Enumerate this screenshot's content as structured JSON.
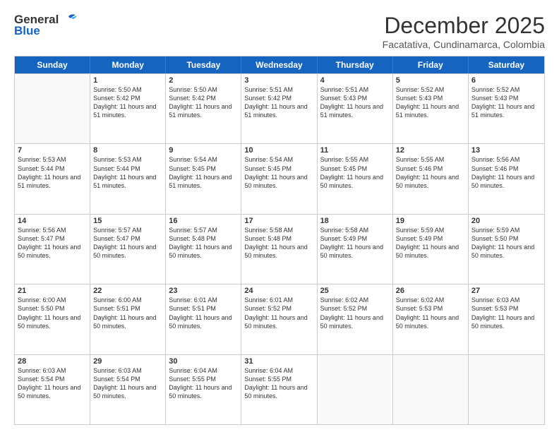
{
  "header": {
    "logo_general": "General",
    "logo_blue": "Blue",
    "month_title": "December 2025",
    "subtitle": "Facatativa, Cundinamarca, Colombia"
  },
  "days_of_week": [
    "Sunday",
    "Monday",
    "Tuesday",
    "Wednesday",
    "Thursday",
    "Friday",
    "Saturday"
  ],
  "weeks": [
    [
      {
        "day": "",
        "empty": true
      },
      {
        "day": "1",
        "sunrise": "5:50 AM",
        "sunset": "5:42 PM",
        "daylight": "11 hours and 51 minutes."
      },
      {
        "day": "2",
        "sunrise": "5:50 AM",
        "sunset": "5:42 PM",
        "daylight": "11 hours and 51 minutes."
      },
      {
        "day": "3",
        "sunrise": "5:51 AM",
        "sunset": "5:42 PM",
        "daylight": "11 hours and 51 minutes."
      },
      {
        "day": "4",
        "sunrise": "5:51 AM",
        "sunset": "5:43 PM",
        "daylight": "11 hours and 51 minutes."
      },
      {
        "day": "5",
        "sunrise": "5:52 AM",
        "sunset": "5:43 PM",
        "daylight": "11 hours and 51 minutes."
      },
      {
        "day": "6",
        "sunrise": "5:52 AM",
        "sunset": "5:43 PM",
        "daylight": "11 hours and 51 minutes."
      }
    ],
    [
      {
        "day": "7",
        "sunrise": "5:53 AM",
        "sunset": "5:44 PM",
        "daylight": "11 hours and 51 minutes."
      },
      {
        "day": "8",
        "sunrise": "5:53 AM",
        "sunset": "5:44 PM",
        "daylight": "11 hours and 51 minutes."
      },
      {
        "day": "9",
        "sunrise": "5:54 AM",
        "sunset": "5:45 PM",
        "daylight": "11 hours and 51 minutes."
      },
      {
        "day": "10",
        "sunrise": "5:54 AM",
        "sunset": "5:45 PM",
        "daylight": "11 hours and 50 minutes."
      },
      {
        "day": "11",
        "sunrise": "5:55 AM",
        "sunset": "5:45 PM",
        "daylight": "11 hours and 50 minutes."
      },
      {
        "day": "12",
        "sunrise": "5:55 AM",
        "sunset": "5:46 PM",
        "daylight": "11 hours and 50 minutes."
      },
      {
        "day": "13",
        "sunrise": "5:56 AM",
        "sunset": "5:46 PM",
        "daylight": "11 hours and 50 minutes."
      }
    ],
    [
      {
        "day": "14",
        "sunrise": "5:56 AM",
        "sunset": "5:47 PM",
        "daylight": "11 hours and 50 minutes."
      },
      {
        "day": "15",
        "sunrise": "5:57 AM",
        "sunset": "5:47 PM",
        "daylight": "11 hours and 50 minutes."
      },
      {
        "day": "16",
        "sunrise": "5:57 AM",
        "sunset": "5:48 PM",
        "daylight": "11 hours and 50 minutes."
      },
      {
        "day": "17",
        "sunrise": "5:58 AM",
        "sunset": "5:48 PM",
        "daylight": "11 hours and 50 minutes."
      },
      {
        "day": "18",
        "sunrise": "5:58 AM",
        "sunset": "5:49 PM",
        "daylight": "11 hours and 50 minutes."
      },
      {
        "day": "19",
        "sunrise": "5:59 AM",
        "sunset": "5:49 PM",
        "daylight": "11 hours and 50 minutes."
      },
      {
        "day": "20",
        "sunrise": "5:59 AM",
        "sunset": "5:50 PM",
        "daylight": "11 hours and 50 minutes."
      }
    ],
    [
      {
        "day": "21",
        "sunrise": "6:00 AM",
        "sunset": "5:50 PM",
        "daylight": "11 hours and 50 minutes."
      },
      {
        "day": "22",
        "sunrise": "6:00 AM",
        "sunset": "5:51 PM",
        "daylight": "11 hours and 50 minutes."
      },
      {
        "day": "23",
        "sunrise": "6:01 AM",
        "sunset": "5:51 PM",
        "daylight": "11 hours and 50 minutes."
      },
      {
        "day": "24",
        "sunrise": "6:01 AM",
        "sunset": "5:52 PM",
        "daylight": "11 hours and 50 minutes."
      },
      {
        "day": "25",
        "sunrise": "6:02 AM",
        "sunset": "5:52 PM",
        "daylight": "11 hours and 50 minutes."
      },
      {
        "day": "26",
        "sunrise": "6:02 AM",
        "sunset": "5:53 PM",
        "daylight": "11 hours and 50 minutes."
      },
      {
        "day": "27",
        "sunrise": "6:03 AM",
        "sunset": "5:53 PM",
        "daylight": "11 hours and 50 minutes."
      }
    ],
    [
      {
        "day": "28",
        "sunrise": "6:03 AM",
        "sunset": "5:54 PM",
        "daylight": "11 hours and 50 minutes."
      },
      {
        "day": "29",
        "sunrise": "6:03 AM",
        "sunset": "5:54 PM",
        "daylight": "11 hours and 50 minutes."
      },
      {
        "day": "30",
        "sunrise": "6:04 AM",
        "sunset": "5:55 PM",
        "daylight": "11 hours and 50 minutes."
      },
      {
        "day": "31",
        "sunrise": "6:04 AM",
        "sunset": "5:55 PM",
        "daylight": "11 hours and 50 minutes."
      },
      {
        "day": "",
        "empty": true
      },
      {
        "day": "",
        "empty": true
      },
      {
        "day": "",
        "empty": true
      }
    ]
  ]
}
